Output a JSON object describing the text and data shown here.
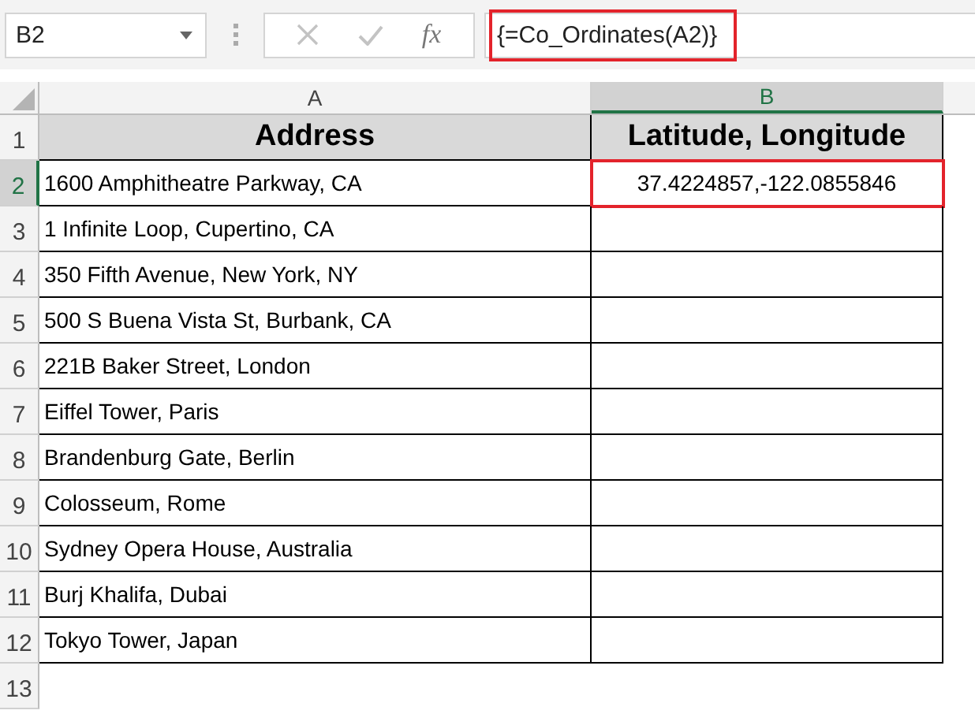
{
  "name_box": {
    "value": "B2"
  },
  "function_button": "fx",
  "formula_bar": {
    "value": "{=Co_Ordinates(A2)}",
    "highlighted": true
  },
  "columns": [
    {
      "label": "A",
      "selected": false
    },
    {
      "label": "B",
      "selected": true
    }
  ],
  "rows": [
    {
      "number": "1",
      "selected": false,
      "kind": "header",
      "cells": [
        {
          "text": "Address",
          "selected": false
        },
        {
          "text": "Latitude, Longitude",
          "selected": false
        }
      ]
    },
    {
      "number": "2",
      "selected": true,
      "kind": "data",
      "cells": [
        {
          "text": "1600 Amphitheatre Parkway, CA",
          "selected": false
        },
        {
          "text": "37.4224857,-122.0855846",
          "selected": true
        }
      ]
    },
    {
      "number": "3",
      "selected": false,
      "kind": "data",
      "cells": [
        {
          "text": "1 Infinite Loop, Cupertino, CA",
          "selected": false
        },
        {
          "selected": false
        }
      ]
    },
    {
      "number": "4",
      "selected": false,
      "kind": "data",
      "cells": [
        {
          "text": "350 Fifth Avenue, New York, NY",
          "selected": false
        },
        {
          "selected": false
        }
      ]
    },
    {
      "number": "5",
      "selected": false,
      "kind": "data",
      "cells": [
        {
          "text": "500 S Buena Vista St, Burbank, CA",
          "selected": false
        },
        {
          "selected": false
        }
      ]
    },
    {
      "number": "6",
      "selected": false,
      "kind": "data",
      "cells": [
        {
          "text": "221B Baker Street, London",
          "selected": false
        },
        {
          "selected": false
        }
      ]
    },
    {
      "number": "7",
      "selected": false,
      "kind": "data",
      "cells": [
        {
          "text": "Eiffel Tower, Paris",
          "selected": false
        },
        {
          "selected": false
        }
      ]
    },
    {
      "number": "8",
      "selected": false,
      "kind": "data",
      "cells": [
        {
          "text": "Brandenburg Gate, Berlin",
          "selected": false
        },
        {
          "selected": false
        }
      ]
    },
    {
      "number": "9",
      "selected": false,
      "kind": "data",
      "cells": [
        {
          "text": "Colosseum, Rome",
          "selected": false
        },
        {
          "selected": false
        }
      ]
    },
    {
      "number": "10",
      "selected": false,
      "kind": "data",
      "cells": [
        {
          "text": "Sydney Opera House, Australia",
          "selected": false
        },
        {
          "selected": false
        }
      ]
    },
    {
      "number": "11",
      "selected": false,
      "kind": "data",
      "cells": [
        {
          "text": "Burj Khalifa, Dubai",
          "selected": false
        },
        {
          "selected": false
        }
      ]
    },
    {
      "number": "12",
      "selected": false,
      "kind": "data",
      "cells": [
        {
          "text": "Tokyo Tower, Japan",
          "selected": false
        },
        {
          "selected": false
        }
      ]
    },
    {
      "number": "13",
      "selected": false,
      "kind": "empty"
    }
  ]
}
